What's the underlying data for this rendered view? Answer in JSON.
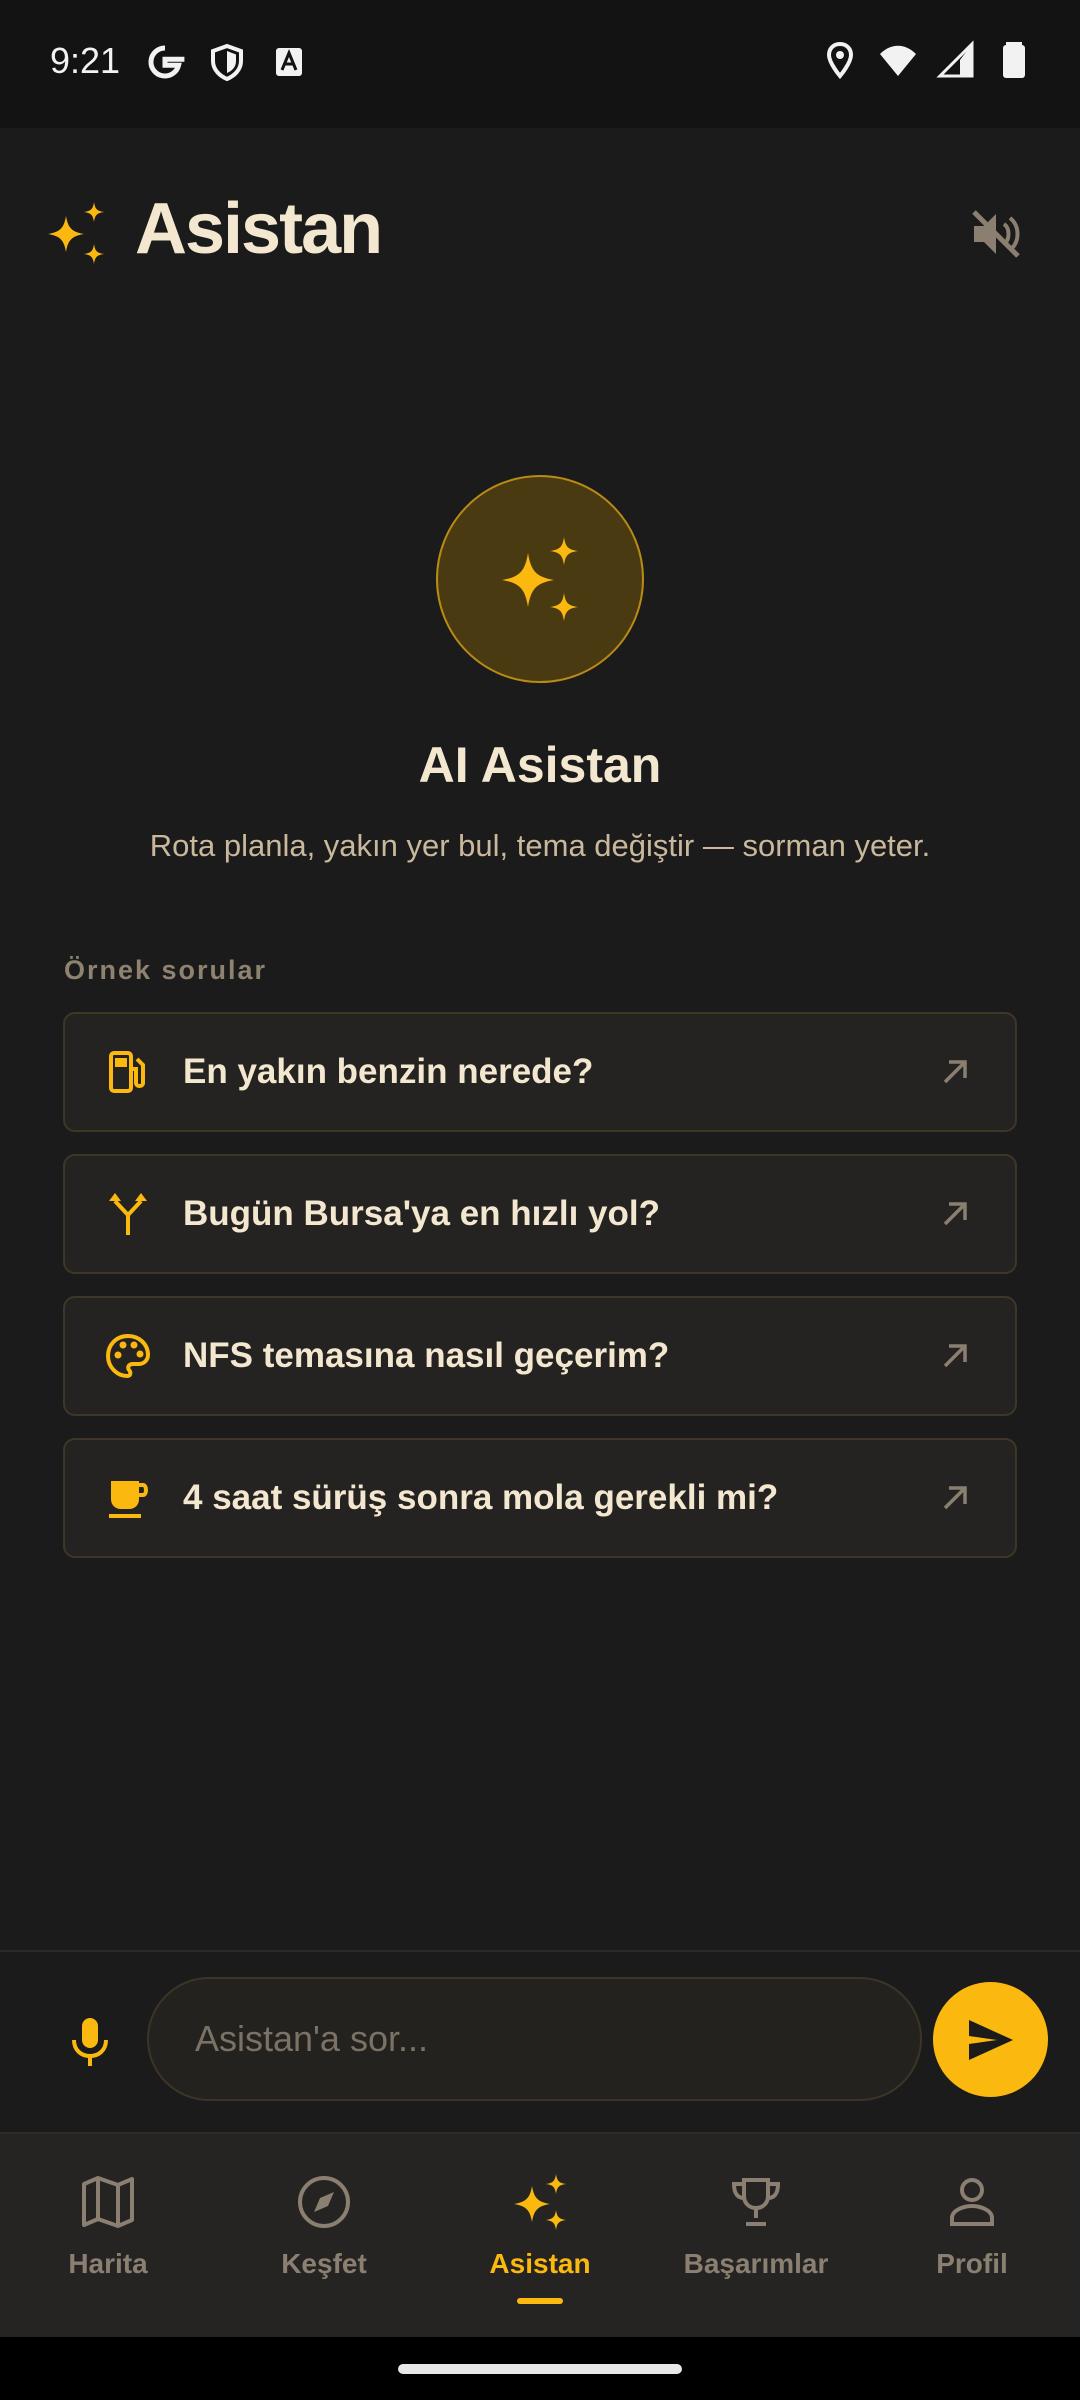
{
  "status_bar": {
    "time": "9:21",
    "left_icons": [
      "google-icon",
      "shield-icon",
      "translate-icon"
    ],
    "right_icons": [
      "location-icon",
      "wifi-icon",
      "signal-icon",
      "battery-icon"
    ]
  },
  "header": {
    "title": "Asistan",
    "icon": "sparkle-icon",
    "mute_icon": "volume-off-icon"
  },
  "hero": {
    "title": "AI Asistan",
    "subtitle": "Rota planla, yakın yer bul, tema değiştir — sorman yeter."
  },
  "examples": {
    "label": "Örnek sorular",
    "items": [
      {
        "text": "En yakın benzin nerede?",
        "icon": "fuel-icon"
      },
      {
        "text": "Bugün Bursa'ya en hızlı yol?",
        "icon": "fork-route-icon"
      },
      {
        "text": "NFS temasına nasıl geçerim?",
        "icon": "palette-icon"
      },
      {
        "text": "4 saat sürüş sonra mola gerekli mi?",
        "icon": "coffee-icon"
      }
    ]
  },
  "input": {
    "placeholder": "Asistan'a sor...",
    "value": ""
  },
  "nav": {
    "items": [
      {
        "label": "Harita",
        "icon": "map-icon",
        "active": false
      },
      {
        "label": "Keşfet",
        "icon": "compass-icon",
        "active": false
      },
      {
        "label": "Asistan",
        "icon": "sparkle-icon",
        "active": true
      },
      {
        "label": "Başarımlar",
        "icon": "trophy-icon",
        "active": false
      },
      {
        "label": "Profil",
        "icon": "person-icon",
        "active": false
      }
    ]
  },
  "colors": {
    "accent": "#fbb910",
    "background": "#1c1b1c",
    "text_primary": "#f4e7d0",
    "text_muted": "#8a7f70"
  }
}
